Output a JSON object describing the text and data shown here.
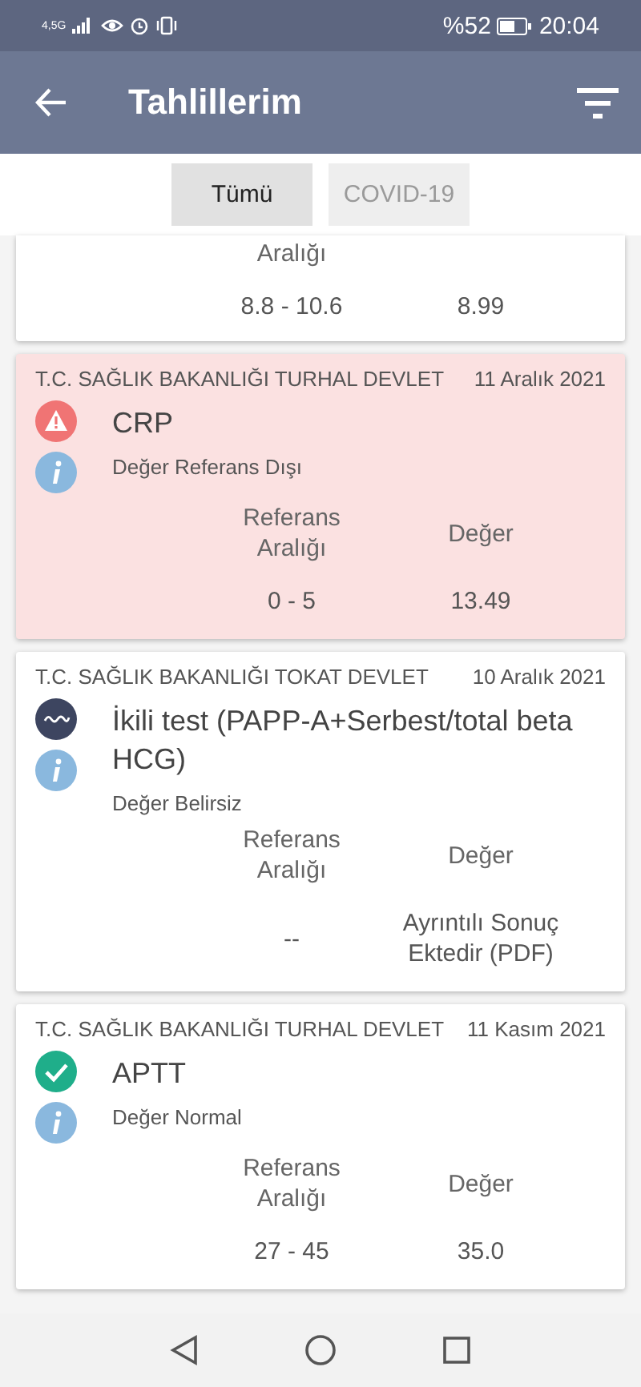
{
  "status_bar": {
    "network": "4,5G",
    "battery_text": "%52",
    "time": "20:04"
  },
  "app_bar": {
    "title": "Tahlillerim"
  },
  "tabs": [
    {
      "label": "Tümü",
      "selected": true
    },
    {
      "label": "COVID-19",
      "selected": false
    }
  ],
  "partial_card": {
    "range_header": "Aralığı",
    "range": "8.8 - 10.6",
    "value": "8.99"
  },
  "results": [
    {
      "kind": "abnormal",
      "hospital": "T.C. SAĞLIK BAKANLIĞI TURHAL DEVLET",
      "date": "11 Aralık 2021",
      "name": "CRP",
      "status": "Değer Referans Dışı",
      "range_header": "Referans Aralığı",
      "value_header": "Değer",
      "range": "0 - 5",
      "value": "13.49"
    },
    {
      "kind": "uncertain",
      "hospital": "T.C. SAĞLIK BAKANLIĞI TOKAT DEVLET",
      "date": "10 Aralık 2021",
      "name": "İkili test (PAPP-A+Serbest/total beta HCG)",
      "status": "Değer Belirsiz",
      "range_header": "Referans Aralığı",
      "value_header": "Değer",
      "range": "--",
      "value": "Ayrıntılı Sonuç Ektedir (PDF)"
    },
    {
      "kind": "normal",
      "hospital": "T.C. SAĞLIK BAKANLIĞI TURHAL DEVLET",
      "date": "11 Kasım 2021",
      "name": "APTT",
      "status": "Değer Normal",
      "range_header": "Referans Aralığı",
      "value_header": "Değer",
      "range": "27 - 45",
      "value": "35.0"
    }
  ]
}
